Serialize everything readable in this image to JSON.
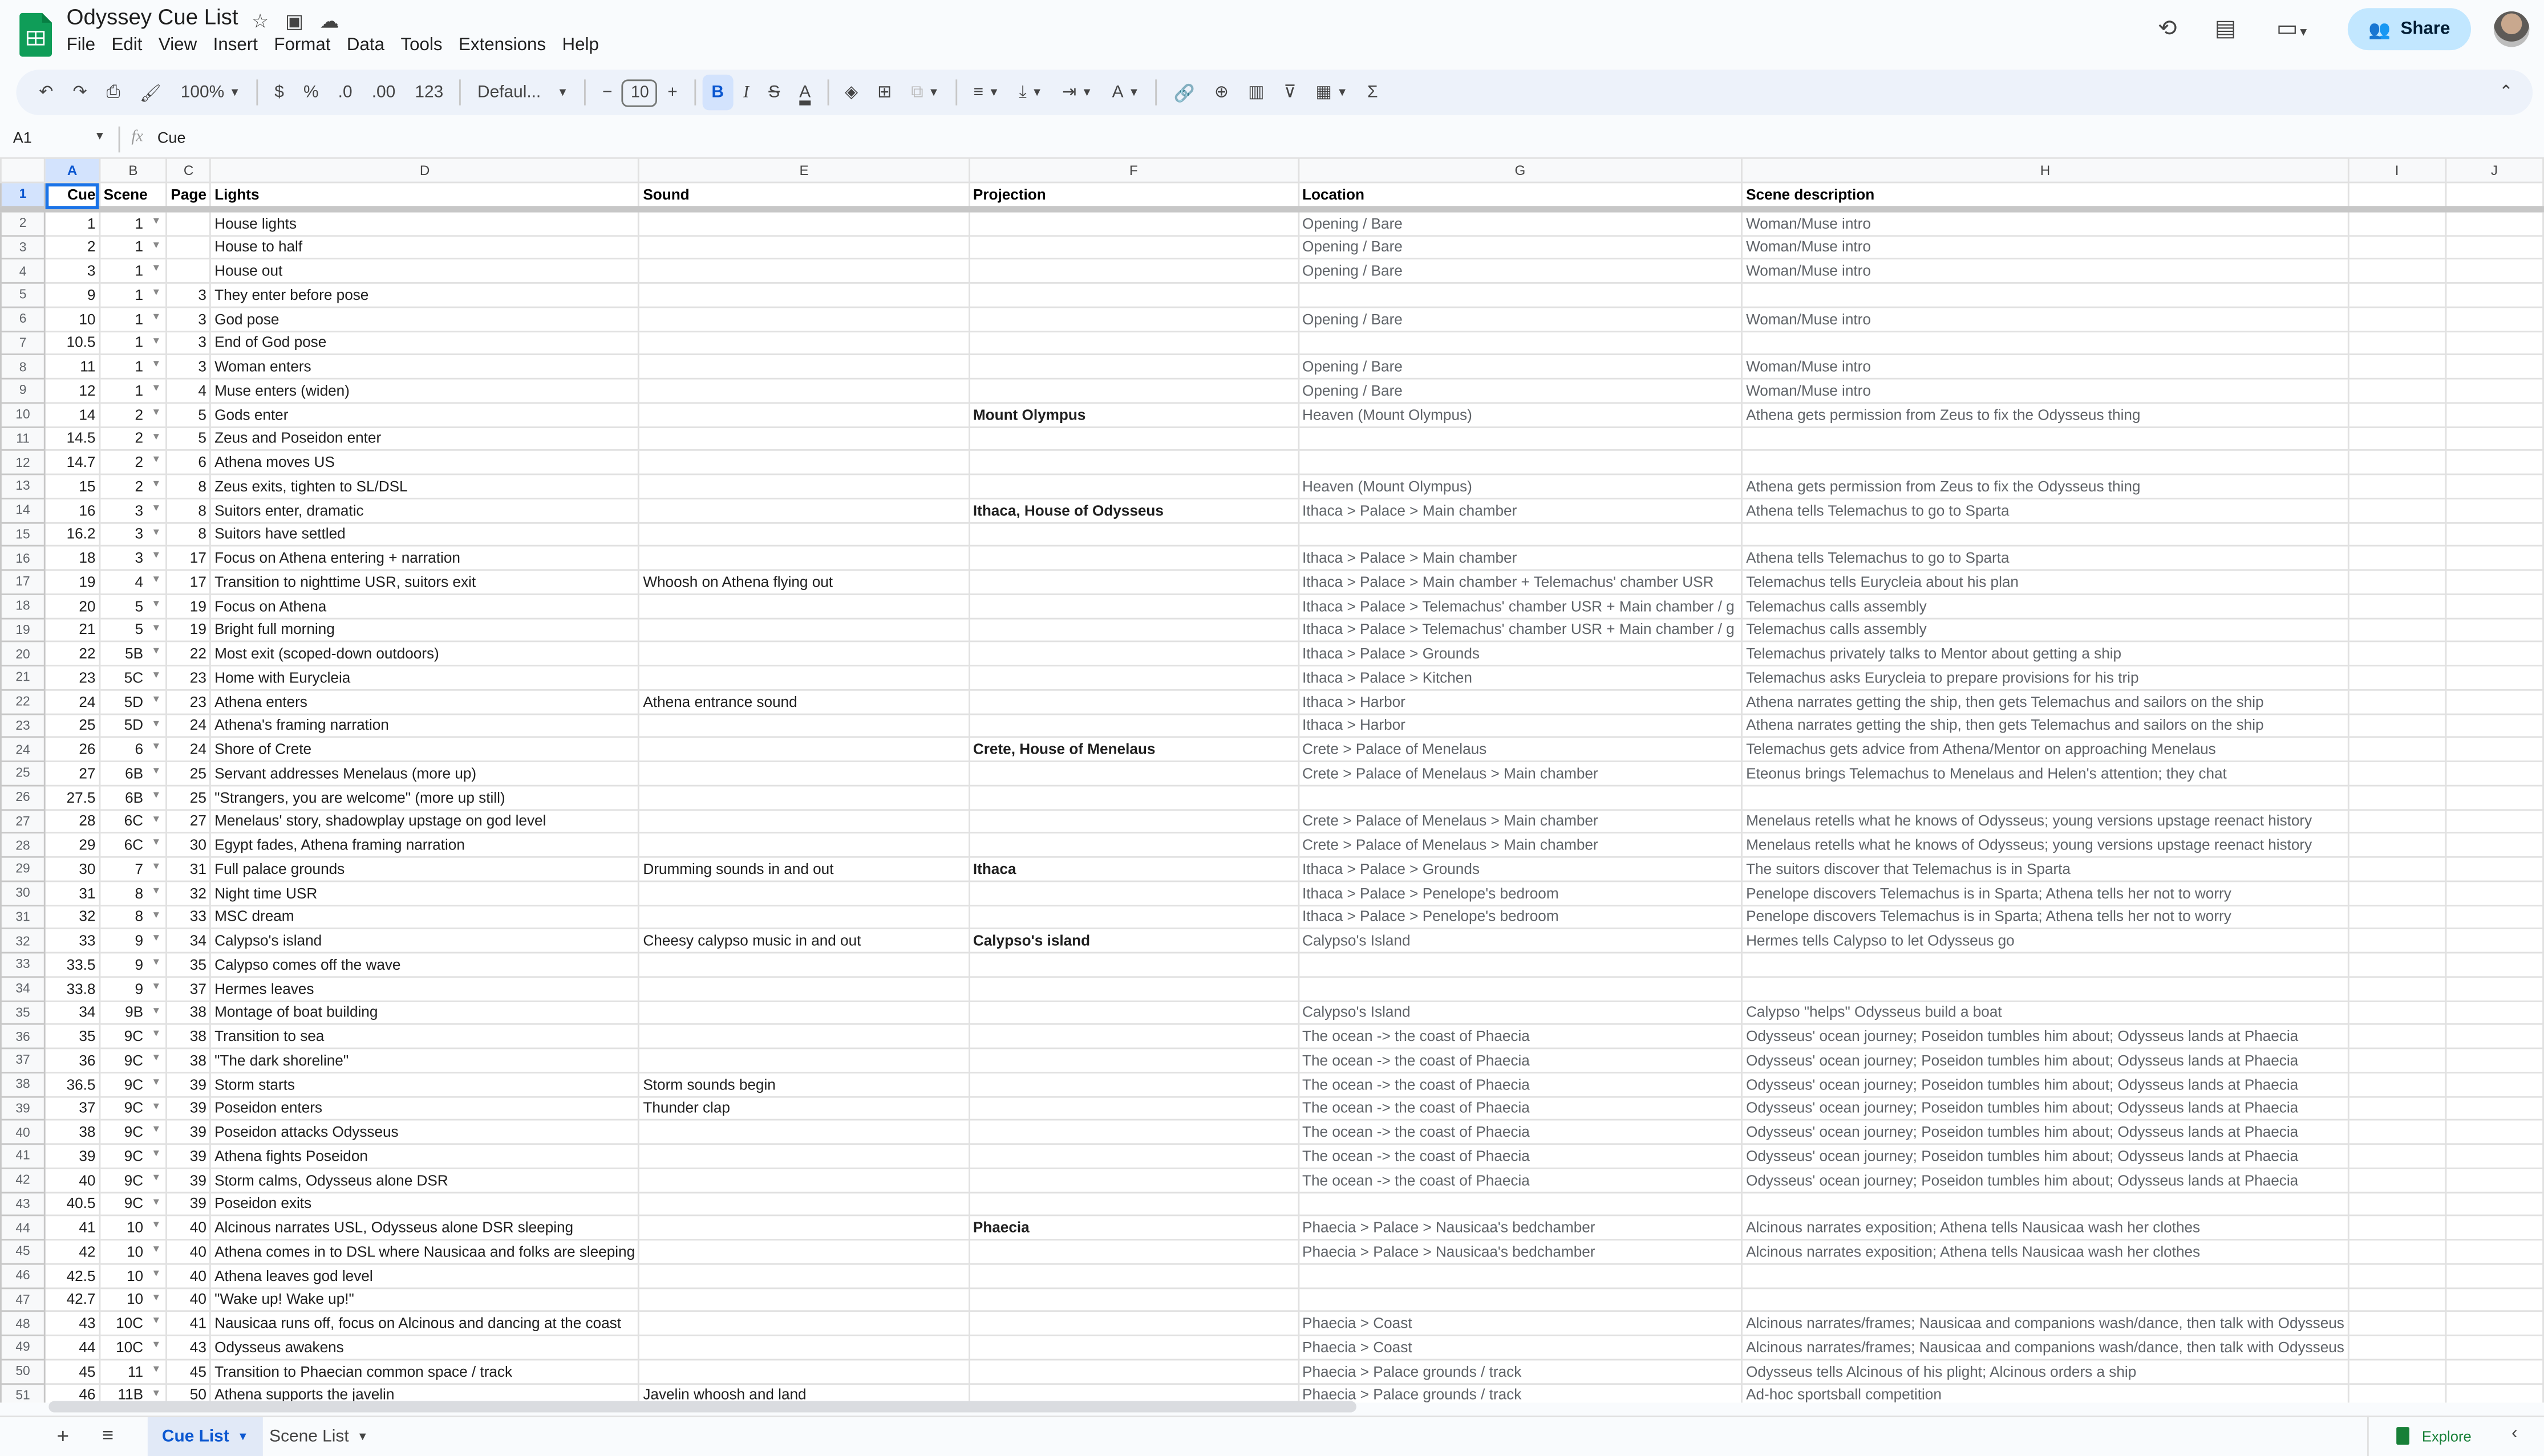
{
  "app": {
    "title": "Odyssey Cue List",
    "menu": [
      "File",
      "Edit",
      "View",
      "Insert",
      "Format",
      "Data",
      "Tools",
      "Extensions",
      "Help"
    ],
    "share_label": "Share"
  },
  "toolbar": {
    "zoom": "100%",
    "currency": "$",
    "percent": "%",
    "dec_decrease": ".0",
    "dec_increase": ".00",
    "number_format": "123",
    "font": "Defaul...",
    "font_size": "10",
    "minus": "−",
    "plus": "+"
  },
  "formula_bar": {
    "cell_ref": "A1",
    "fx": "fx",
    "value": "Cue"
  },
  "columns": [
    "A",
    "B",
    "C",
    "D",
    "E",
    "F",
    "G",
    "H",
    "I",
    "J"
  ],
  "header_row": [
    "Cue",
    "Scene",
    "Page",
    "Lights",
    "Sound",
    "Projection",
    "Location",
    "Scene description"
  ],
  "rows": [
    {
      "n": "2",
      "cue": "1",
      "scene": "1",
      "page": "",
      "lights": "House lights",
      "sound": "",
      "proj": "",
      "loc": "Opening / Bare",
      "desc": "Woman/Muse intro"
    },
    {
      "n": "3",
      "cue": "2",
      "scene": "1",
      "page": "",
      "lights": "House to half",
      "sound": "",
      "proj": "",
      "loc": "Opening / Bare",
      "desc": "Woman/Muse intro"
    },
    {
      "n": "4",
      "cue": "3",
      "scene": "1",
      "page": "",
      "lights": "House out",
      "sound": "",
      "proj": "",
      "loc": "Opening / Bare",
      "desc": "Woman/Muse intro"
    },
    {
      "n": "5",
      "cue": "9",
      "scene": "1",
      "page": "3",
      "lights": "They enter before pose",
      "sound": "",
      "proj": "",
      "loc": "",
      "desc": ""
    },
    {
      "n": "6",
      "cue": "10",
      "scene": "1",
      "page": "3",
      "lights": "God pose",
      "sound": "",
      "proj": "",
      "loc": "Opening / Bare",
      "desc": "Woman/Muse intro"
    },
    {
      "n": "7",
      "cue": "10.5",
      "scene": "1",
      "page": "3",
      "lights": "End of God pose",
      "sound": "",
      "proj": "",
      "loc": "",
      "desc": ""
    },
    {
      "n": "8",
      "cue": "11",
      "scene": "1",
      "page": "3",
      "lights": "Woman enters",
      "sound": "",
      "proj": "",
      "loc": "Opening / Bare",
      "desc": "Woman/Muse intro"
    },
    {
      "n": "9",
      "cue": "12",
      "scene": "1",
      "page": "4",
      "lights": "Muse enters (widen)",
      "sound": "",
      "proj": "",
      "loc": "Opening / Bare",
      "desc": "Woman/Muse intro"
    },
    {
      "n": "10",
      "cue": "14",
      "scene": "2",
      "page": "5",
      "lights": "Gods enter",
      "sound": "",
      "proj": "Mount Olympus",
      "loc": "Heaven (Mount Olympus)",
      "desc": "Athena gets permission from Zeus to fix the Odysseus thing"
    },
    {
      "n": "11",
      "cue": "14.5",
      "scene": "2",
      "page": "5",
      "lights": "Zeus and Poseidon enter",
      "sound": "",
      "proj": "",
      "loc": "",
      "desc": ""
    },
    {
      "n": "12",
      "cue": "14.7",
      "scene": "2",
      "page": "6",
      "lights": "Athena moves US",
      "sound": "",
      "proj": "",
      "loc": "",
      "desc": ""
    },
    {
      "n": "13",
      "cue": "15",
      "scene": "2",
      "page": "8",
      "lights": "Zeus exits, tighten to SL/DSL",
      "sound": "",
      "proj": "",
      "loc": "Heaven (Mount Olympus)",
      "desc": "Athena gets permission from Zeus to fix the Odysseus thing"
    },
    {
      "n": "14",
      "cue": "16",
      "scene": "3",
      "page": "8",
      "lights": "Suitors enter, dramatic",
      "sound": "",
      "proj": "Ithaca, House of Odysseus",
      "loc": "Ithaca > Palace > Main chamber",
      "desc": "Athena tells Telemachus to go to Sparta"
    },
    {
      "n": "15",
      "cue": "16.2",
      "scene": "3",
      "page": "8",
      "lights": "Suitors have settled",
      "sound": "",
      "proj": "",
      "loc": "",
      "desc": ""
    },
    {
      "n": "16",
      "cue": "18",
      "scene": "3",
      "page": "17",
      "lights": "Focus on Athena entering + narration",
      "sound": "",
      "proj": "",
      "loc": "Ithaca > Palace > Main chamber",
      "desc": "Athena tells Telemachus to go to Sparta"
    },
    {
      "n": "17",
      "cue": "19",
      "scene": "4",
      "page": "17",
      "lights": "Transition to nighttime USR, suitors exit",
      "sound": "Whoosh on Athena flying out",
      "proj": "",
      "loc": "Ithaca > Palace > Main chamber + Telemachus' chamber USR",
      "desc": "Telemachus tells Eurycleia about his plan"
    },
    {
      "n": "18",
      "cue": "20",
      "scene": "5",
      "page": "19",
      "lights": "Focus on Athena",
      "sound": "",
      "proj": "",
      "loc": "Ithaca > Palace > Telemachus' chamber USR + Main chamber / g",
      "desc": "Telemachus calls assembly"
    },
    {
      "n": "19",
      "cue": "21",
      "scene": "5",
      "page": "19",
      "lights": "Bright full morning",
      "sound": "",
      "proj": "",
      "loc": "Ithaca > Palace > Telemachus' chamber USR + Main chamber / g",
      "desc": "Telemachus calls assembly"
    },
    {
      "n": "20",
      "cue": "22",
      "scene": "5B",
      "page": "22",
      "lights": "Most exit (scoped-down outdoors)",
      "sound": "",
      "proj": "",
      "loc": "Ithaca > Palace > Grounds",
      "desc": "Telemachus privately talks to Mentor about getting a ship"
    },
    {
      "n": "21",
      "cue": "23",
      "scene": "5C",
      "page": "23",
      "lights": "Home with Eurycleia",
      "sound": "",
      "proj": "",
      "loc": "Ithaca > Palace > Kitchen",
      "desc": "Telemachus asks Eurycleia to prepare provisions for his trip"
    },
    {
      "n": "22",
      "cue": "24",
      "scene": "5D",
      "page": "23",
      "lights": "Athena enters",
      "sound": "Athena entrance sound",
      "proj": "",
      "loc": "Ithaca > Harbor",
      "desc": "Athena narrates getting the ship, then gets Telemachus and sailors on the ship"
    },
    {
      "n": "23",
      "cue": "25",
      "scene": "5D",
      "page": "24",
      "lights": "Athena's framing narration",
      "sound": "",
      "proj": "",
      "loc": "Ithaca > Harbor",
      "desc": "Athena narrates getting the ship, then gets Telemachus and sailors on the ship"
    },
    {
      "n": "24",
      "cue": "26",
      "scene": "6",
      "page": "24",
      "lights": "Shore of Crete",
      "sound": "",
      "proj": "Crete, House of Menelaus",
      "loc": "Crete > Palace of Menelaus",
      "desc": "Telemachus gets advice from Athena/Mentor on approaching Menelaus"
    },
    {
      "n": "25",
      "cue": "27",
      "scene": "6B",
      "page": "25",
      "lights": "Servant addresses Menelaus (more up)",
      "sound": "",
      "proj": "",
      "loc": "Crete > Palace of Menelaus > Main chamber",
      "desc": "Eteonus brings Telemachus to Menelaus and Helen's attention; they chat"
    },
    {
      "n": "26",
      "cue": "27.5",
      "scene": "6B",
      "page": "25",
      "lights": "\"Strangers, you are welcome\" (more up still)",
      "sound": "",
      "proj": "",
      "loc": "",
      "desc": ""
    },
    {
      "n": "27",
      "cue": "28",
      "scene": "6C",
      "page": "27",
      "lights": "Menelaus' story, shadowplay upstage on god level",
      "sound": "",
      "proj": "",
      "loc": "Crete > Palace of Menelaus > Main chamber",
      "desc": "Menelaus retells what he knows of Odysseus; young versions upstage reenact history"
    },
    {
      "n": "28",
      "cue": "29",
      "scene": "6C",
      "page": "30",
      "lights": "Egypt fades, Athena framing narration",
      "sound": "",
      "proj": "",
      "loc": "Crete > Palace of Menelaus > Main chamber",
      "desc": "Menelaus retells what he knows of Odysseus; young versions upstage reenact history"
    },
    {
      "n": "29",
      "cue": "30",
      "scene": "7",
      "page": "31",
      "lights": "Full palace grounds",
      "sound": "Drumming sounds in and out",
      "proj": "Ithaca",
      "loc": "Ithaca > Palace > Grounds",
      "desc": "The suitors discover that Telemachus is in Sparta"
    },
    {
      "n": "30",
      "cue": "31",
      "scene": "8",
      "page": "32",
      "lights": "Night time USR",
      "sound": "",
      "proj": "",
      "loc": "Ithaca > Palace > Penelope's bedroom",
      "desc": "Penelope discovers Telemachus is in Sparta; Athena tells her not to worry"
    },
    {
      "n": "31",
      "cue": "32",
      "scene": "8",
      "page": "33",
      "lights": "MSC dream",
      "sound": "",
      "proj": "",
      "loc": "Ithaca > Palace > Penelope's bedroom",
      "desc": "Penelope discovers Telemachus is in Sparta; Athena tells her not to worry"
    },
    {
      "n": "32",
      "cue": "33",
      "scene": "9",
      "page": "34",
      "lights": "Calypso's island",
      "sound": "Cheesy calypso music in and out",
      "proj": "Calypso's island",
      "loc": "Calypso's Island",
      "desc": "Hermes tells Calypso to let Odysseus go"
    },
    {
      "n": "33",
      "cue": "33.5",
      "scene": "9",
      "page": "35",
      "lights": "Calypso comes off the wave",
      "sound": "",
      "proj": "",
      "loc": "",
      "desc": ""
    },
    {
      "n": "34",
      "cue": "33.8",
      "scene": "9",
      "page": "37",
      "lights": "Hermes leaves",
      "sound": "",
      "proj": "",
      "loc": "",
      "desc": ""
    },
    {
      "n": "35",
      "cue": "34",
      "scene": "9B",
      "page": "38",
      "lights": "Montage of boat building",
      "sound": "",
      "proj": "",
      "loc": "Calypso's Island",
      "desc": "Calypso \"helps\" Odysseus build a boat"
    },
    {
      "n": "36",
      "cue": "35",
      "scene": "9C",
      "page": "38",
      "lights": "Transition to sea",
      "sound": "",
      "proj": "",
      "loc": "The ocean -> the coast of Phaecia",
      "desc": "Odysseus' ocean journey; Poseidon tumbles him about; Odysseus lands at Phaecia"
    },
    {
      "n": "37",
      "cue": "36",
      "scene": "9C",
      "page": "38",
      "lights": "\"The dark shoreline\"",
      "sound": "",
      "proj": "",
      "loc": "The ocean -> the coast of Phaecia",
      "desc": "Odysseus' ocean journey; Poseidon tumbles him about; Odysseus lands at Phaecia"
    },
    {
      "n": "38",
      "cue": "36.5",
      "scene": "9C",
      "page": "39",
      "lights": "Storm starts",
      "sound": "Storm sounds begin",
      "proj": "",
      "loc": "The ocean -> the coast of Phaecia",
      "desc": "Odysseus' ocean journey; Poseidon tumbles him about; Odysseus lands at Phaecia"
    },
    {
      "n": "39",
      "cue": "37",
      "scene": "9C",
      "page": "39",
      "lights": "Poseidon enters",
      "sound": "Thunder clap",
      "proj": "",
      "loc": "The ocean -> the coast of Phaecia",
      "desc": "Odysseus' ocean journey; Poseidon tumbles him about; Odysseus lands at Phaecia"
    },
    {
      "n": "40",
      "cue": "38",
      "scene": "9C",
      "page": "39",
      "lights": "Poseidon attacks Odysseus",
      "sound": "",
      "proj": "",
      "loc": "The ocean -> the coast of Phaecia",
      "desc": "Odysseus' ocean journey; Poseidon tumbles him about; Odysseus lands at Phaecia"
    },
    {
      "n": "41",
      "cue": "39",
      "scene": "9C",
      "page": "39",
      "lights": "Athena fights Poseidon",
      "sound": "",
      "proj": "",
      "loc": "The ocean -> the coast of Phaecia",
      "desc": "Odysseus' ocean journey; Poseidon tumbles him about; Odysseus lands at Phaecia"
    },
    {
      "n": "42",
      "cue": "40",
      "scene": "9C",
      "page": "39",
      "lights": "Storm calms, Odysseus alone DSR",
      "sound": "",
      "proj": "",
      "loc": "The ocean -> the coast of Phaecia",
      "desc": "Odysseus' ocean journey; Poseidon tumbles him about; Odysseus lands at Phaecia"
    },
    {
      "n": "43",
      "cue": "40.5",
      "scene": "9C",
      "page": "39",
      "lights": "Poseidon exits",
      "sound": "",
      "proj": "",
      "loc": "",
      "desc": ""
    },
    {
      "n": "44",
      "cue": "41",
      "scene": "10",
      "page": "40",
      "lights": "Alcinous narrates USL, Odysseus alone DSR sleeping",
      "sound": "",
      "proj": "Phaecia",
      "loc": "Phaecia > Palace > Nausicaa's bedchamber",
      "desc": "Alcinous narrates exposition; Athena tells Nausicaa wash her clothes"
    },
    {
      "n": "45",
      "cue": "42",
      "scene": "10",
      "page": "40",
      "lights": "Athena comes in to DSL where Nausicaa and folks are sleeping",
      "sound": "",
      "proj": "",
      "loc": "Phaecia > Palace > Nausicaa's bedchamber",
      "desc": "Alcinous narrates exposition; Athena tells Nausicaa wash her clothes"
    },
    {
      "n": "46",
      "cue": "42.5",
      "scene": "10",
      "page": "40",
      "lights": "Athena leaves god level",
      "sound": "",
      "proj": "",
      "loc": "",
      "desc": ""
    },
    {
      "n": "47",
      "cue": "42.7",
      "scene": "10",
      "page": "40",
      "lights": "\"Wake up! Wake up!\"",
      "sound": "",
      "proj": "",
      "loc": "",
      "desc": ""
    },
    {
      "n": "48",
      "cue": "43",
      "scene": "10C",
      "page": "41",
      "lights": "Nausicaa runs off, focus on Alcinous and dancing at the coast",
      "sound": "",
      "proj": "",
      "loc": "Phaecia > Coast",
      "desc": "Alcinous narrates/frames; Nausicaa and companions wash/dance, then talk with Odysseus"
    },
    {
      "n": "49",
      "cue": "44",
      "scene": "10C",
      "page": "43",
      "lights": "Odysseus awakens",
      "sound": "",
      "proj": "",
      "loc": "Phaecia > Coast",
      "desc": "Alcinous narrates/frames; Nausicaa and companions wash/dance, then talk with Odysseus"
    },
    {
      "n": "50",
      "cue": "45",
      "scene": "11",
      "page": "45",
      "lights": "Transition to Phaecian common space / track",
      "sound": "",
      "proj": "",
      "loc": "Phaecia > Palace grounds / track",
      "desc": "Odysseus tells Alcinous of his plight; Alcinous orders a ship"
    },
    {
      "n": "51",
      "cue": "46",
      "scene": "11B",
      "page": "50",
      "lights": "Athena supports the javelin",
      "sound": "Javelin whoosh and land",
      "proj": "",
      "loc": "Phaecia > Palace grounds / track",
      "desc": "Ad-hoc sportsball competition"
    }
  ],
  "sheets": {
    "active": "Cue List",
    "other": "Scene List"
  },
  "explore_label": "Explore",
  "colors": {
    "accent": "#0b57d0",
    "share_bg": "#c2e7ff",
    "sheets_green": "#188038",
    "selection": "#1a73e8"
  }
}
